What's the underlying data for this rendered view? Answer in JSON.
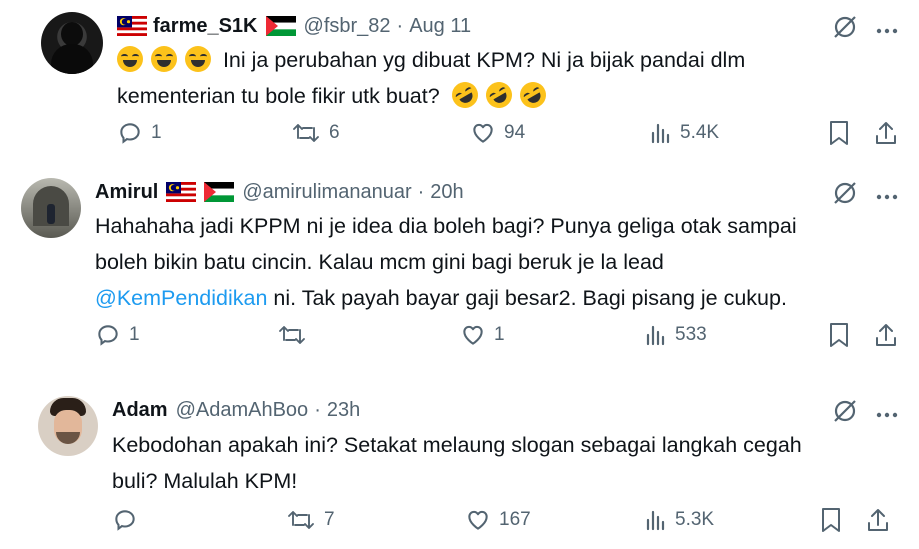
{
  "replies": [
    {
      "name": "farme_S1K",
      "handle": "@fsbr_82",
      "separator": "·",
      "time": "Aug 11",
      "text_after_emoji": "Ini ja perubahan yg dibuat KPM? Ni ja bijak pandai dlm",
      "text_line2": "kementerian tu bole fikir utk buat?",
      "reply_count": "1",
      "retweet_count": "6",
      "like_count": "94",
      "view_count": "5.4K",
      "leading_emoji": "grinning-squinting-face",
      "trailing_emoji": "rolling-on-floor-laughing"
    },
    {
      "name": "Amirul",
      "handle": "@amirulimananuar",
      "separator": "·",
      "time": "20h",
      "line1": "Hahahaha jadi KPPM ni je idea dia boleh bagi? Punya geliga otak sampai",
      "line2": "boleh bikin batu cincin. Kalau mcm gini bagi beruk je la lead",
      "mention": "@KemPendidikan",
      "line3_rest": " ni. Tak payah bayar gaji besar2. Bagi pisang je cukup.",
      "reply_count": "1",
      "retweet_count": "",
      "like_count": "1",
      "view_count": "533"
    },
    {
      "name": "Adam",
      "handle": "@AdamAhBoo",
      "separator": "·",
      "time": "23h",
      "line1": "Kebodohan apakah ini? Setakat melaung slogan sebagai langkah cegah",
      "line2": "buli? Malulah KPM!",
      "reply_count": "",
      "retweet_count": "7",
      "like_count": "167",
      "view_count": "5.3K"
    }
  ],
  "colors": {
    "text": "#0f1419",
    "secondary": "#536471",
    "link": "#1d9bf0"
  },
  "icons": [
    "reply-icon",
    "retweet-icon",
    "like-icon",
    "views-icon",
    "bookmark-icon",
    "share-icon",
    "grok-icon",
    "more-icon",
    "malaysia-flag-icon",
    "palestine-flag-icon"
  ]
}
